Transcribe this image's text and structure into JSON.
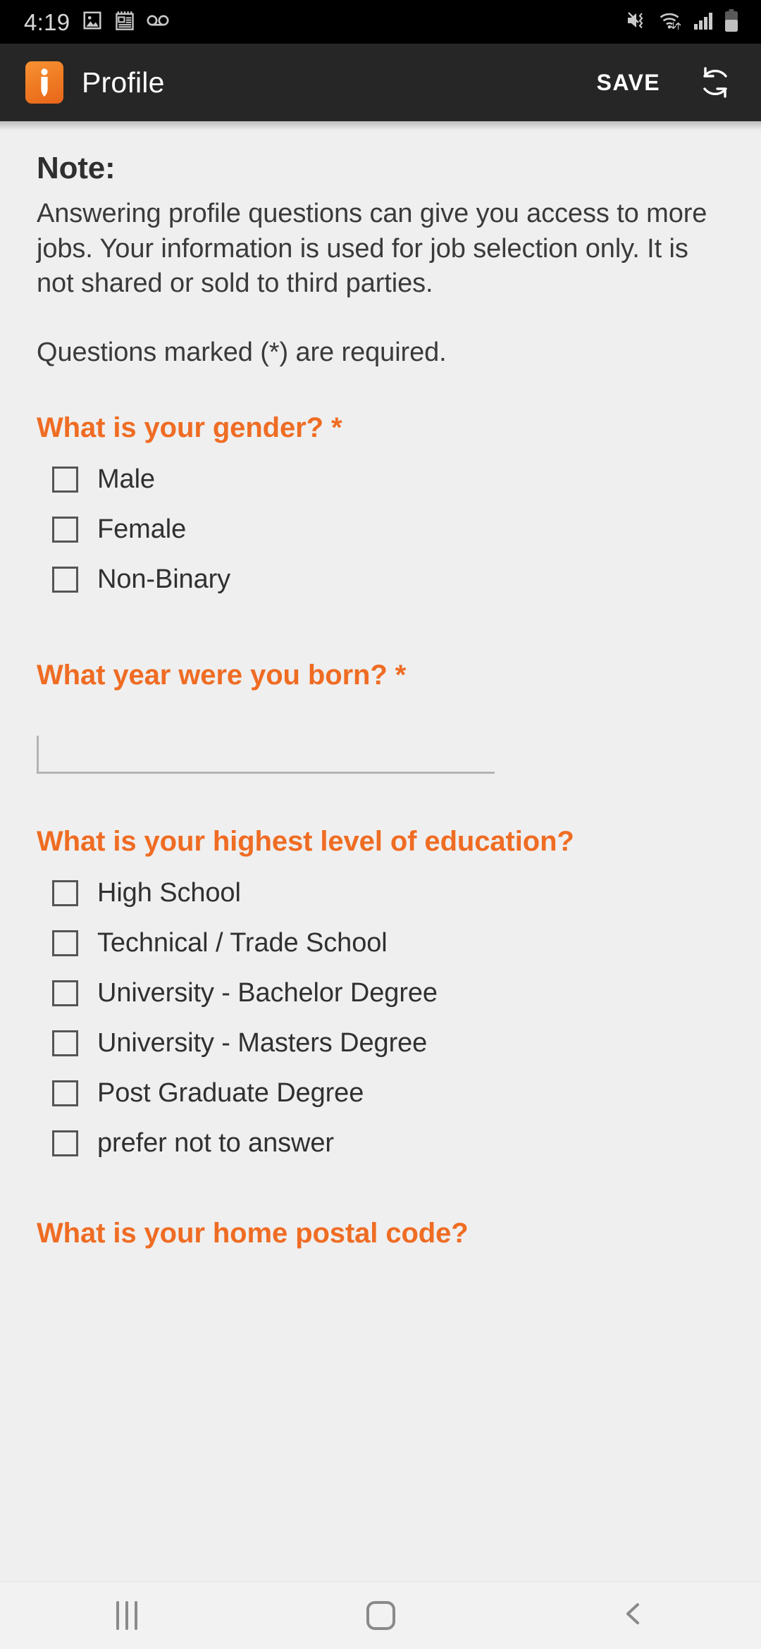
{
  "status_bar": {
    "time": "4:19",
    "left_icons": [
      "image-icon",
      "news-calendar-icon",
      "voicemail-icon"
    ],
    "right_icons": [
      "mute-vibrate-icon",
      "wifi-transfer-icon",
      "cellular-signal-icon",
      "battery-icon"
    ],
    "background": "#000000"
  },
  "app_bar": {
    "logo": "indeed-i-logo-icon",
    "title": "Profile",
    "save_label": "SAVE",
    "refresh_icon": "refresh-sync-icon",
    "background": "#262626",
    "accent": "#ef6c23"
  },
  "content": {
    "note_heading": "Note:",
    "note_body": "Answering profile questions can give you access to more jobs. Your information is used for job selection only. It is not shared or sold to third parties.",
    "note_required": "Questions marked (*) are required.",
    "questions": [
      {
        "id": "gender",
        "label": "What is your gender? *",
        "type": "checkbox-group",
        "options": [
          {
            "label": "Male",
            "checked": false
          },
          {
            "label": "Female",
            "checked": false
          },
          {
            "label": "Non-Binary",
            "checked": false
          }
        ]
      },
      {
        "id": "birth-year",
        "label": "What year were you born? *",
        "type": "text-input",
        "value": "",
        "placeholder": ""
      },
      {
        "id": "education",
        "label": "What is your highest level of education?",
        "type": "checkbox-group",
        "options": [
          {
            "label": "High School",
            "checked": false
          },
          {
            "label": "Technical / Trade School",
            "checked": false
          },
          {
            "label": "University - Bachelor Degree",
            "checked": false
          },
          {
            "label": "University - Masters Degree",
            "checked": false
          },
          {
            "label": "Post Graduate Degree",
            "checked": false
          },
          {
            "label": "prefer not to answer",
            "checked": false
          }
        ]
      },
      {
        "id": "postal-code",
        "label": "What is your home postal code?",
        "type": "text-input",
        "value": "",
        "placeholder": ""
      }
    ]
  },
  "nav_bar": {
    "recents_label": "recents-icon",
    "home_label": "home-icon",
    "back_label": "back-icon",
    "background": "#f2f2f2"
  },
  "colors": {
    "accent_orange": "#ef6c23",
    "page_background": "#efefef",
    "app_bar_background": "#262626",
    "text_primary": "#303030",
    "checkbox_border": "#555555"
  }
}
